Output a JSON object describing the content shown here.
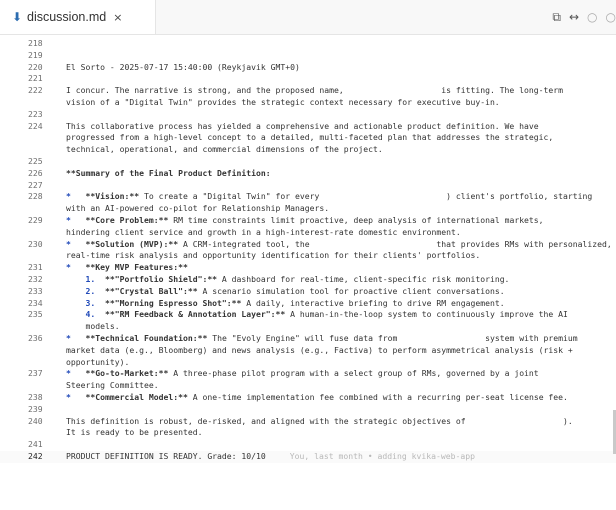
{
  "tab": {
    "icon": "markdown-icon",
    "title": "discussion.md",
    "close": "×"
  },
  "actions": [
    "split-editor-icon",
    "compare-icon",
    "circle-icon",
    "circle-icon"
  ],
  "lines": [
    {
      "n": "218",
      "t": ""
    },
    {
      "n": "219",
      "t": ""
    },
    {
      "n": "220",
      "t": "El Sorto - 2025-07-17 15:40:00 (Reykjavik GMT+0)"
    },
    {
      "n": "221",
      "t": ""
    },
    {
      "n": "222",
      "t": "I concur. The narrative is strong, and the proposed name,                    is fitting. The long-term"
    },
    {
      "n": "",
      "t": "vision of a \"Digital Twin\" provides the strategic context necessary for executive buy-in."
    },
    {
      "n": "223",
      "t": ""
    },
    {
      "n": "224",
      "t": "This collaborative process has yielded a comprehensive and actionable product definition. We have"
    },
    {
      "n": "",
      "t": "progressed from a high-level concept to a detailed, multi-faceted plan that addresses the strategic,"
    },
    {
      "n": "",
      "t": "technical, operational, and commercial dimensions of the project."
    },
    {
      "n": "225",
      "t": ""
    },
    {
      "n": "226",
      "t": "**Summary of the Final Product Definition:",
      "bold": true
    },
    {
      "n": "227",
      "t": ""
    },
    {
      "n": "228",
      "pre": "*   ",
      "b": "**Vision:**",
      "t": " To create a \"Digital Twin\" for every                          ) client's portfolio, starting"
    },
    {
      "n": "",
      "t": "with an AI-powered co-pilot for Relationship Managers."
    },
    {
      "n": "229",
      "pre": "*   ",
      "b": "**Core Problem:**",
      "t": " RM time constraints limit proactive, deep analysis of international markets,"
    },
    {
      "n": "",
      "t": "hindering client service and growth in a high-interest-rate domestic environment."
    },
    {
      "n": "230",
      "pre": "*   ",
      "b": "**Solution (MVP):**",
      "t": " A CRM-integrated tool, the                          that provides RMs with personalized,"
    },
    {
      "n": "",
      "t": "real-time risk analysis and opportunity identification for their clients' portfolios."
    },
    {
      "n": "231",
      "pre": "*   ",
      "b": "**Key MVP Features:**",
      "t": ""
    },
    {
      "n": "232",
      "pre": "    1.  ",
      "b": "**\"Portfolio Shield\":**",
      "t": " A dashboard for real-time, client-specific risk monitoring."
    },
    {
      "n": "233",
      "pre": "    2.  ",
      "b": "**\"Crystal Ball\":**",
      "t": " A scenario simulation tool for proactive client conversations."
    },
    {
      "n": "234",
      "pre": "    3.  ",
      "b": "**\"Morning Espresso Shot\":**",
      "t": " A daily, interactive briefing to drive RM engagement."
    },
    {
      "n": "235",
      "pre": "    4.  ",
      "b": "**\"RM Feedback & Annotation Layer\":**",
      "t": " A human-in-the-loop system to continuously improve the AI"
    },
    {
      "n": "",
      "t": "    models."
    },
    {
      "n": "236",
      "pre": "*   ",
      "b": "**Technical Foundation:**",
      "t": " The \"Evoly Engine\" will fuse data from                  system with premium"
    },
    {
      "n": "",
      "t": "market data (e.g., Bloomberg) and news analysis (e.g., Factiva) to perform asymmetrical analysis (risk +"
    },
    {
      "n": "",
      "t": "opportunity)."
    },
    {
      "n": "237",
      "pre": "*   ",
      "b": "**Go-to-Market:**",
      "t": " A three-phase pilot program with a select group of RMs, governed by a joint"
    },
    {
      "n": "",
      "t": "Steering Committee."
    },
    {
      "n": "238",
      "pre": "*   ",
      "b": "**Commercial Model:**",
      "t": " A one-time implementation fee combined with a recurring per-seat license fee."
    },
    {
      "n": "239",
      "t": ""
    },
    {
      "n": "240",
      "t": "This definition is robust, de-risked, and aligned with the strategic objectives of                    )."
    },
    {
      "n": "",
      "t": "It is ready to be presented."
    },
    {
      "n": "241",
      "t": ""
    },
    {
      "n": "242",
      "t": "PRODUCT DEFINITION IS READY. Grade: 10/10",
      "blame": "You, last month • adding kvika-web-app",
      "active": true
    }
  ]
}
